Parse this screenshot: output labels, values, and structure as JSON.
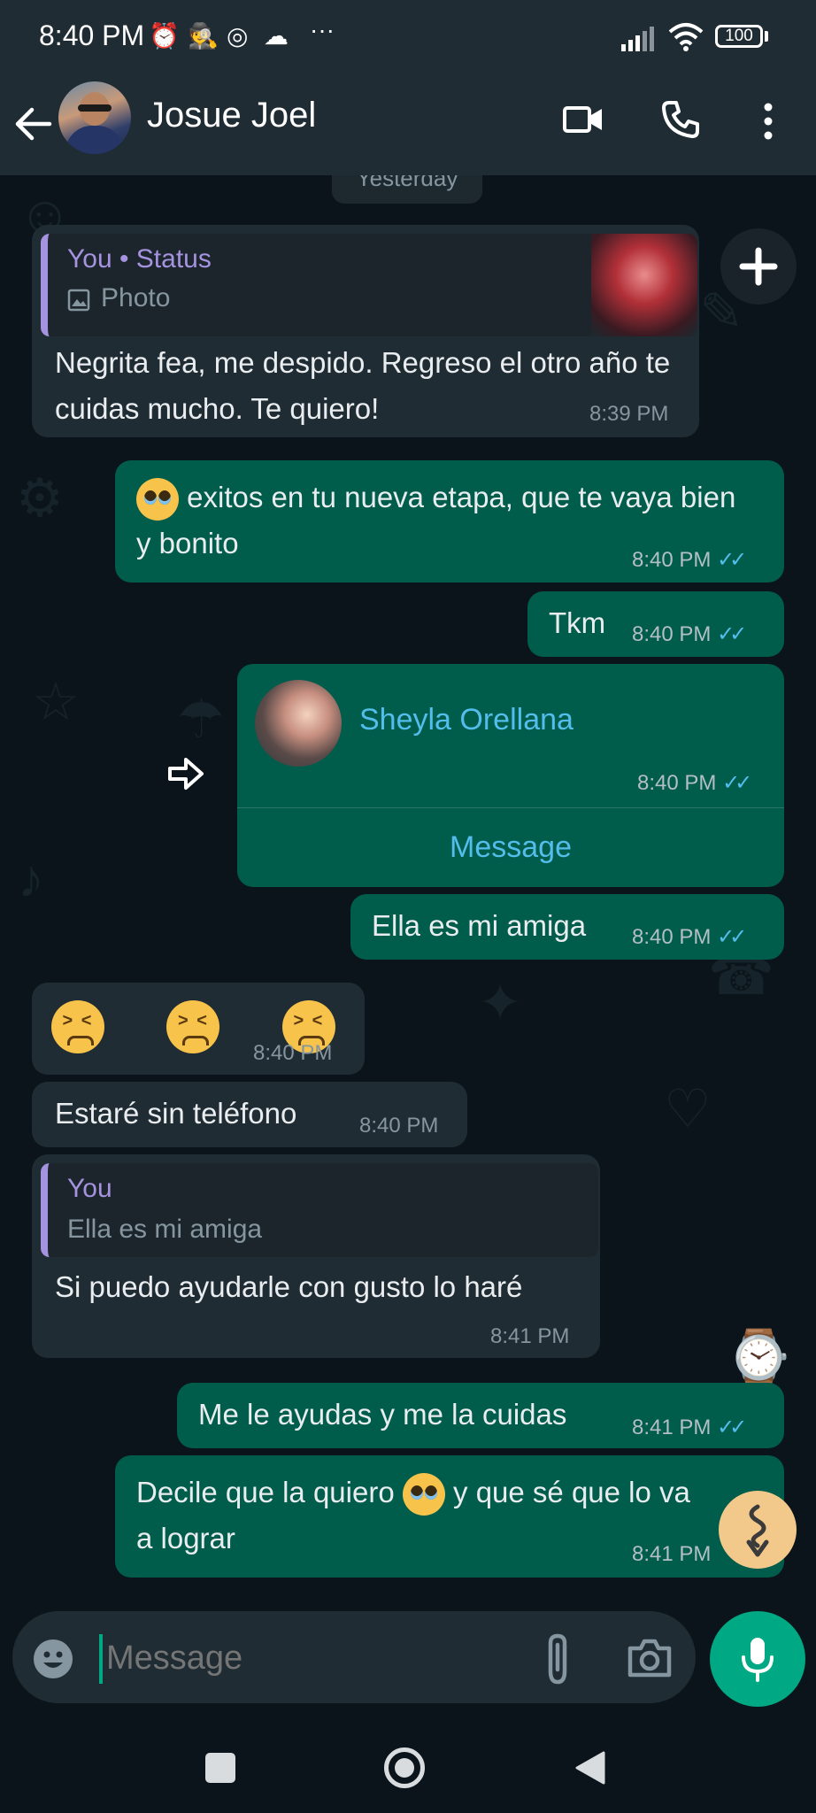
{
  "status_bar": {
    "time": "8:40 PM",
    "icons": [
      "alarm-icon",
      "incognito-icon",
      "instagram-icon",
      "cloud-icon",
      "more-dots-icon"
    ],
    "right_icons": [
      "signal-icon",
      "wifi-icon"
    ],
    "battery": "100"
  },
  "header": {
    "contact_name": "Josue Joel",
    "icons": [
      "back-arrow-icon",
      "video-call-icon",
      "voice-call-icon",
      "kebab-menu-icon"
    ]
  },
  "chat": {
    "date_label": "Yesterday",
    "msg1": {
      "quote_title": "You • Status",
      "quote_type": "Photo",
      "text": "Negrita fea, me despido. Regreso el otro año te cuidas mucho. Te quiero!",
      "time": "8:39 PM"
    },
    "msg2": {
      "text": "exitos en tu nueva etapa, que te vaya bien y bonito",
      "time": "8:40 PM"
    },
    "msg3": {
      "text": "Tkm",
      "time": "8:40 PM"
    },
    "msg4": {
      "contact": "Sheyla Orellana",
      "time": "8:40 PM",
      "action": "Message"
    },
    "msg5": {
      "text": "Ella es mi amiga",
      "time": "8:40 PM"
    },
    "msg6": {
      "time": "8:40 PM"
    },
    "msg7": {
      "text": "Estaré sin teléfono",
      "time": "8:40 PM"
    },
    "msg8": {
      "quote_title": "You",
      "quote_text": "Ella es mi amiga",
      "text": "Si puedo ayudarle con gusto lo haré",
      "time": "8:41 PM"
    },
    "msg9": {
      "text": "Me le ayudas y me la cuidas",
      "time": "8:41 PM"
    },
    "msg10": {
      "text_a": "Decile que la quiero",
      "text_b": "y que sé que lo va",
      "text_c": "a lograr",
      "time": "8:41 PM"
    }
  },
  "input": {
    "placeholder": "Message"
  },
  "colors": {
    "outgoing": "#005c4b",
    "incoming": "#202c33",
    "accent": "#00a884",
    "tick": "#53bdeb",
    "quote_bar": "#a593e0"
  }
}
